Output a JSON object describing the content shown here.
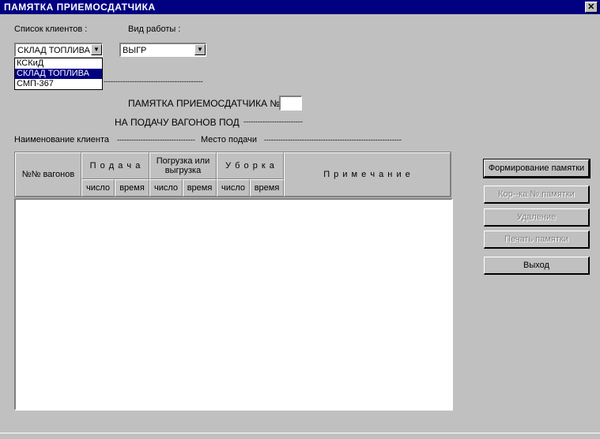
{
  "window": {
    "title": "ПАМЯТКА  ПРИЕМОСДАТЧИКА",
    "close_glyph": "✕"
  },
  "clients": {
    "label": "Список  клиентов :",
    "selected": "СКЛАД ТОПЛИВА",
    "options": [
      "КСКиД",
      "СКЛАД ТОПЛИВА",
      "СМП-367"
    ],
    "highlighted_index": 1
  },
  "work_type": {
    "label": "Вид работы :",
    "selected": "ВЫГР"
  },
  "dotted_line": "------------------------------------------",
  "memo_number_label": "ПАМЯТКА  ПРИЕМОСДАТЧИКА  №",
  "delivery_label": "НА ПОДАЧУ  ВАГОНОВ  ПОД",
  "delivery_dots": "-------------------------",
  "client_name_label": "Наименование клиента",
  "client_name_dots": "---------------------------------",
  "place_label": "Место подачи",
  "place_dots": "----------------------------------------------------------",
  "table": {
    "col_wagons": "№№ вагонов",
    "col_delivery": "П о д а ч а",
    "col_loading": "Погрузка или выгрузка",
    "col_cleanup": "У б о р к а",
    "col_notes": "П р и м е ч а н и е",
    "sub_count": "число",
    "sub_time": "время"
  },
  "buttons": {
    "form": "Формирование памятки",
    "correct": "Кор--ка № памятки",
    "delete": "Удаление",
    "print": "Печать памятки",
    "exit": "Выход"
  }
}
